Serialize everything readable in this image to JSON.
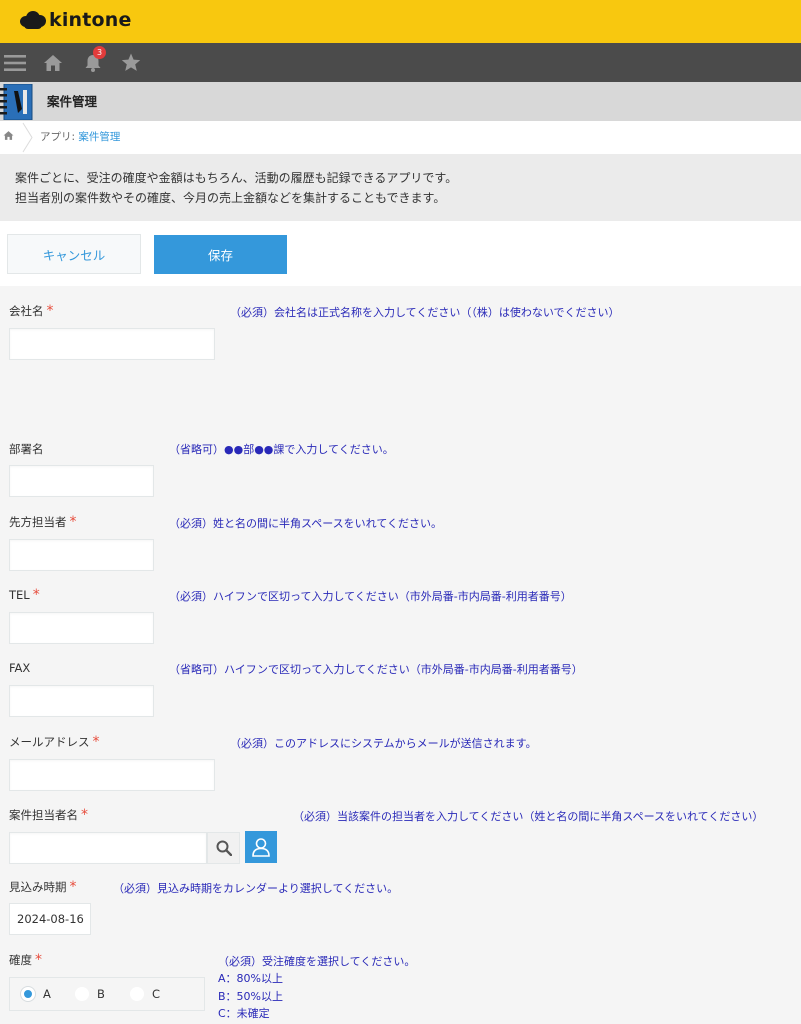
{
  "header": {
    "logo_text": "kintone"
  },
  "globalnav": {
    "notification_count": "3"
  },
  "app": {
    "title": "案件管理"
  },
  "breadcrumb": {
    "prefix": "アプリ: ",
    "app_link": "案件管理"
  },
  "description": {
    "line1": "案件ごとに、受注の確度や金額はもちろん、活動の履歴も記録できるアプリです。",
    "line2": "担当者別の案件数やその確度、今月の売上金額などを集計することもできます。"
  },
  "toolbar": {
    "cancel_label": "キャンセル",
    "save_label": "保存"
  },
  "fields": {
    "company": {
      "label": "会社名",
      "required_mark": "*",
      "hint": "（必須）会社名は正式名称を入力してください（（株）は使わないでください）",
      "value": ""
    },
    "department": {
      "label": "部署名",
      "hint": "（省略可）●●部●●課で入力してください。",
      "value": ""
    },
    "contact": {
      "label": "先方担当者",
      "required_mark": "*",
      "hint": "（必須）姓と名の間に半角スペースをいれてください。",
      "value": ""
    },
    "tel": {
      "label": "TEL",
      "required_mark": "*",
      "hint": "（必須）ハイフンで区切って入力してください（市外局番-市内局番-利用者番号）",
      "value": ""
    },
    "fax": {
      "label": "FAX",
      "hint": "（省略可）ハイフンで区切って入力してください（市外局番-市内局番-利用者番号）",
      "value": ""
    },
    "email": {
      "label": "メールアドレス",
      "required_mark": "*",
      "hint": "（必須）このアドレスにシステムからメールが送信されます。",
      "value": ""
    },
    "owner": {
      "label": "案件担当者名",
      "required_mark": "*",
      "hint": "（必須）当該案件の担当者を入力してください（姓と名の間に半角スペースをいれてください）",
      "value": ""
    },
    "expected_date": {
      "label": "見込み時期",
      "required_mark": "*",
      "hint": "（必須）見込み時期をカレンダーより選択してください。",
      "value": "2024-08-16"
    },
    "certainty": {
      "label": "確度",
      "required_mark": "*",
      "hint_lines": [
        "（必須）受注確度を選択してください。",
        "A：80%以上",
        "B：50%以上",
        "C：未確定"
      ],
      "options": [
        "A",
        "B",
        "C"
      ],
      "selected": "A"
    }
  },
  "colors": {
    "brand": "#f8c80f",
    "accent": "#3498db",
    "required": "#e74c3c",
    "hint": "#2929b8"
  }
}
